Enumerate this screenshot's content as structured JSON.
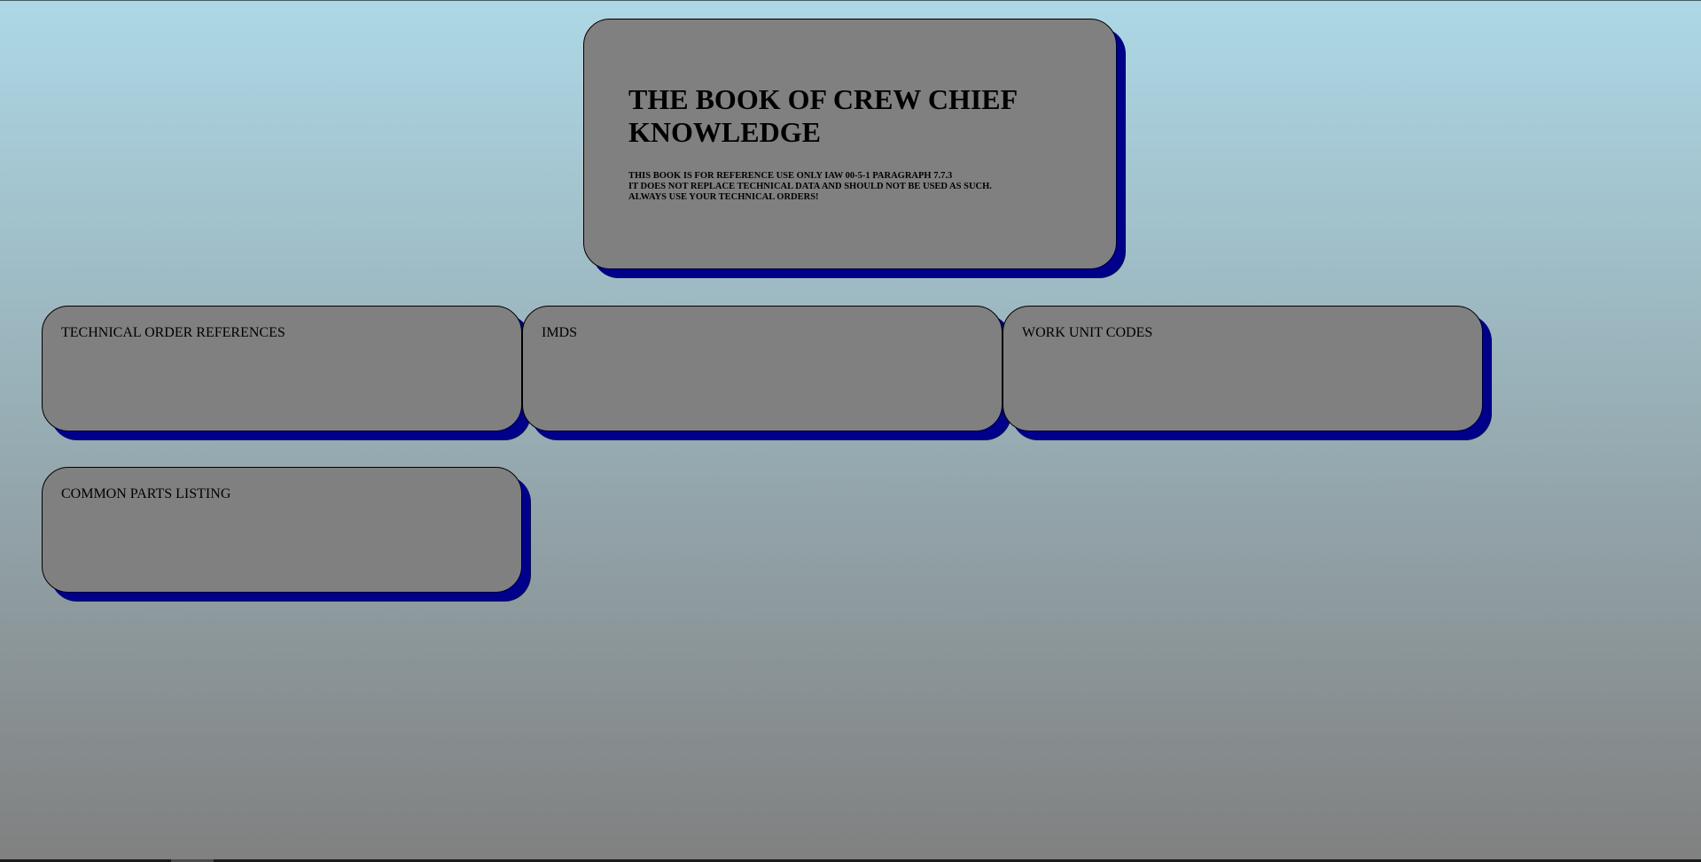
{
  "hero": {
    "title": "THE BOOK OF CREW CHIEF KNOWLEDGE",
    "notice_lines": [
      "THIS BOOK IS FOR REFERENCE USE ONLY IAW 00-5-1 PARAGRAPH 7.7.3",
      "IT DOES NOT REPLACE TECHNICAL DATA AND SHOULD NOT BE USED AS SUCH.",
      "ALWAYS USE YOUR TECHNICAL ORDERS!"
    ]
  },
  "sections": [
    {
      "label": "TECHNICAL ORDER REFERENCES"
    },
    {
      "label": "IMDS"
    },
    {
      "label": "WORK UNIT CODES"
    },
    {
      "label": "COMMON PARTS LISTING"
    }
  ],
  "colors": {
    "background_top": "#add8e6",
    "background_bottom": "#808080",
    "card_fill": "#808080",
    "card_shadow": "#00008b"
  }
}
